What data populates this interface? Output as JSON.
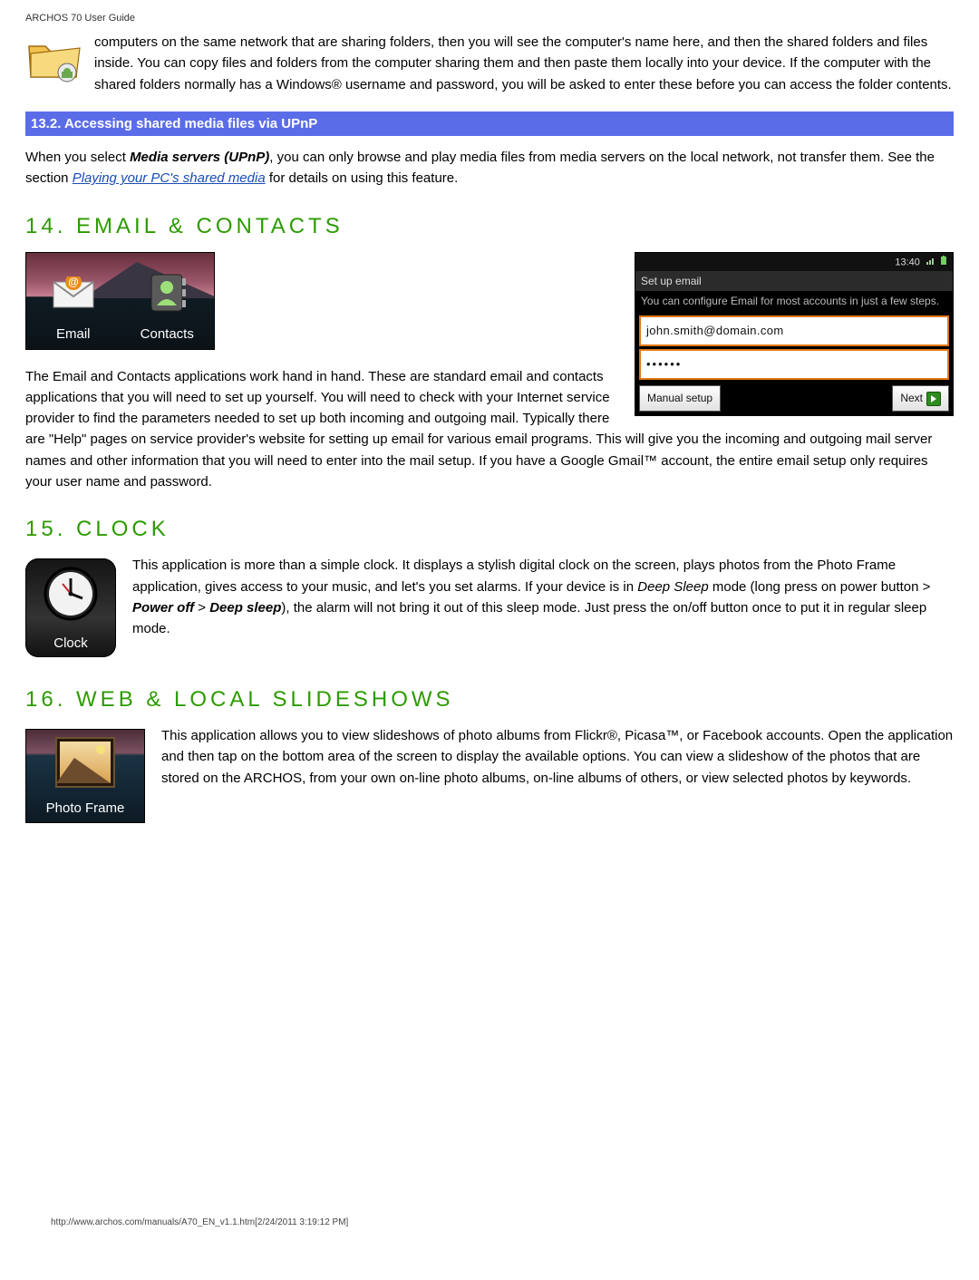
{
  "header": "ARCHOS 70 User Guide",
  "footer": "http://www.archos.com/manuals/A70_EN_v1.1.htm[2/24/2011 3:19:12 PM]",
  "intro_para": "computers on the same network that are sharing folders, then you will see the computer's name here, and then the shared folders and files inside. You can copy files and folders from the computer sharing them and then paste them locally into your device. If the computer with the shared folders normally has a Windows® username and password, you will be asked to enter these before you can access the folder contents.",
  "bar_13_2": "13.2. Accessing shared media files via UPnP",
  "upnp_pre": "When you select ",
  "upnp_bold": "Media servers (UPnP)",
  "upnp_mid": ", you can only browse and play media files from media servers on the local network, not transfer them. See the section ",
  "upnp_link": "Playing your PC's shared media",
  "upnp_post": " for details on using this feature.",
  "h14": "14. EMAIL & CONTACTS",
  "email_thumb": {
    "email_label": "Email",
    "contacts_label": "Contacts"
  },
  "android": {
    "time": "13:40",
    "title": "Set up email",
    "msg": "You can configure Email for most accounts in just a few steps.",
    "email_value": "john.smith@domain.com",
    "pass_value": "••••••",
    "manual_btn": "Manual setup",
    "next_btn": "Next"
  },
  "email_para": "The Email and Contacts applications work hand in hand. These are standard email and contacts applications that you will need to set up yourself. You will need to check with your Internet service provider to find the parameters needed to set up both incoming and outgoing mail. Typically there are \"Help\" pages on service provider's website for setting up email for various email programs. This will give you the incoming and outgoing mail server names and other information that you will need to enter into the mail setup. If you have a Google Gmail™ account, the entire email setup only requires your user name and password.",
  "h15": "15. CLOCK",
  "clock_label": "Clock",
  "clock_para_pre": "This application is more than a simple clock. It displays a stylish digital clock on the screen, plays photos from the Photo Frame application, gives access to your music, and let's you set alarms. If your device is in ",
  "clock_deepsleep1": "Deep Sleep",
  "clock_mid1": " mode (long press on power button > ",
  "clock_poweroff": "Power off",
  "clock_gt": " > ",
  "clock_deepsleep2": "Deep sleep",
  "clock_mid2": "), the alarm will not bring it out of this sleep mode. Just press the on/off button once to put it in regular sleep mode.",
  "h16": "16. WEB & LOCAL SLIDESHOWS",
  "photo_label": "Photo Frame",
  "slideshow_para": "This application allows you to view slideshows of photo albums from Flickr®, Picasa™, or Facebook accounts. Open the application and then tap on the bottom area of the screen to display the available options. You can view a slideshow of the photos that are stored on the ARCHOS, from your own on-line photo albums, on-line albums of others, or view selected photos by keywords."
}
